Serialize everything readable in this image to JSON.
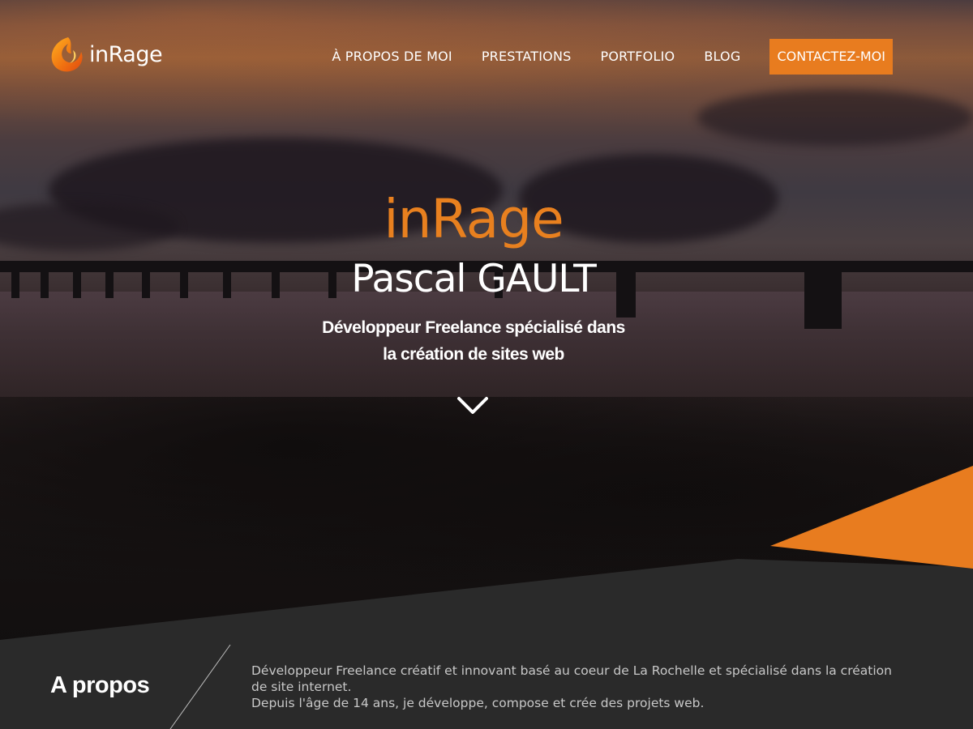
{
  "brand": {
    "logo_text": "inRage",
    "accent_color": "#e87c1f"
  },
  "nav": {
    "items": [
      {
        "label": "À PROPOS DE MOI"
      },
      {
        "label": "PRESTATIONS"
      },
      {
        "label": "PORTFOLIO"
      },
      {
        "label": "BLOG"
      }
    ],
    "cta_label": "CONTACTEZ-MOI"
  },
  "hero": {
    "title": "inRage",
    "name": "Pascal GAULT",
    "subtitle_line1": "Développeur Freelance spécialisé dans",
    "subtitle_line2": "la création de sites web",
    "scroll_icon": "chevron-down-icon"
  },
  "about": {
    "title": "A propos",
    "paragraph1": "Développeur Freelance créatif et innovant basé au coeur de La Rochelle et spécialisé dans la création de site internet.",
    "paragraph2": "Depuis l'âge de 14 ans, je développe, compose et crée des projets web."
  }
}
